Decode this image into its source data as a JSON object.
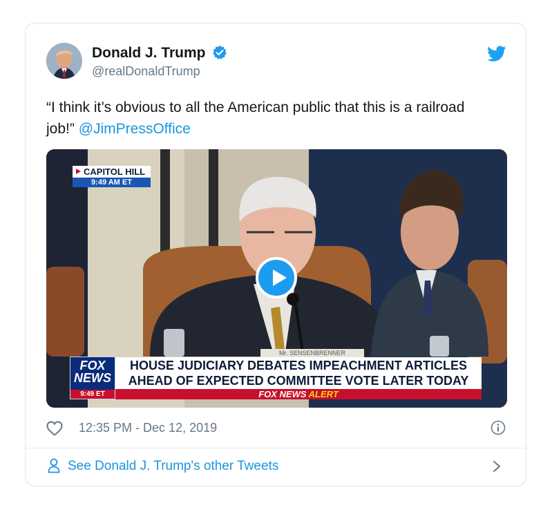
{
  "author": {
    "display_name": "Donald J. Trump",
    "handle": "@realDonaldTrump",
    "verified_icon": "verified-badge-icon"
  },
  "tweet": {
    "text": "“I think it’s obvious to all the American public that this is a railroad job!” ",
    "mention": "@JimPressOffice"
  },
  "media": {
    "location_label": "CAPITOL HILL",
    "location_time": "9:49 AM ET",
    "nameplate": "Mr. SENSENBRENNER",
    "headline_line1": "HOUSE JUDICIARY DEBATES IMPEACHMENT ARTICLES",
    "headline_line2": "AHEAD OF EXPECTED COMMITTEE VOTE LATER TODAY",
    "logo_line1": "FOX",
    "logo_line2": "NEWS",
    "logo_time": "9:49 ET",
    "alert_brand": "FOX NEWS ",
    "alert_word": "ALERT",
    "play_icon": "play-icon"
  },
  "meta": {
    "timestamp": "12:35 PM - Dec 12, 2019"
  },
  "footer": {
    "link_text": "See Donald J. Trump's other Tweets"
  },
  "colors": {
    "accent": "#1b95e0",
    "verified": "#1d9bf0",
    "text": "#14171a",
    "muted": "#657786",
    "fox_red": "#c8102e",
    "fox_blue": "#0a2c7a"
  }
}
